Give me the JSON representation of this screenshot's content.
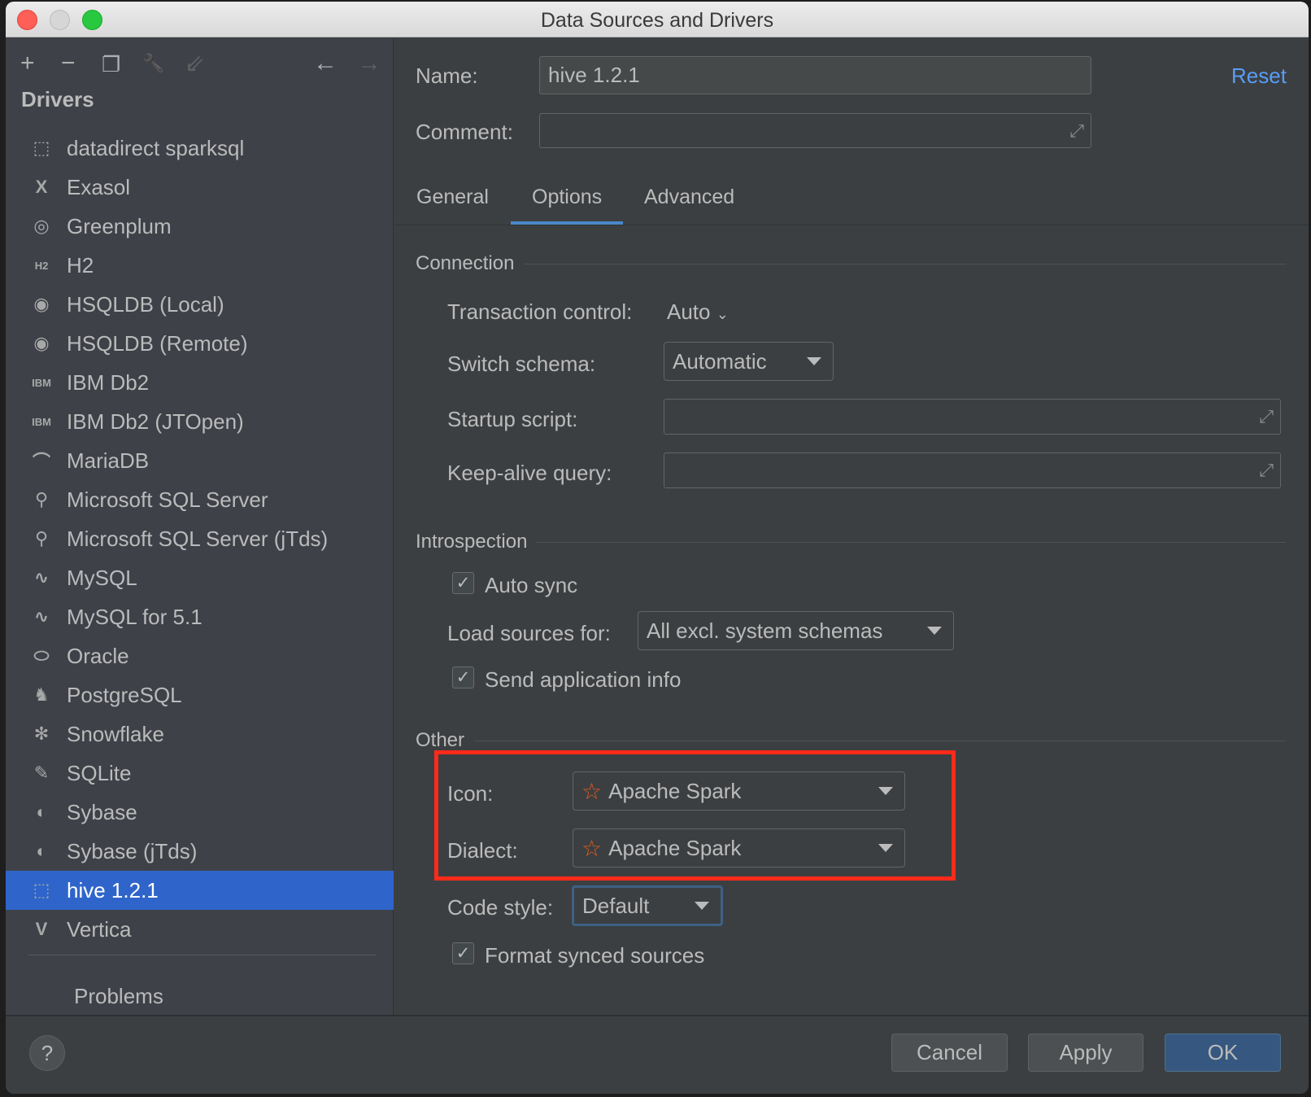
{
  "window": {
    "title": "Data Sources and Drivers"
  },
  "toolbar": {
    "add": "+",
    "remove": "−",
    "copy": "❐",
    "settings": "🔧",
    "import": "⇙",
    "back": "←",
    "forward": "→"
  },
  "sidebar": {
    "heading": "Drivers",
    "items": [
      {
        "label": "datadirect sparksql",
        "icon": "dashed-square-icon",
        "glyph": "⬚"
      },
      {
        "label": "Exasol",
        "icon": "exasol-icon",
        "glyph": "X"
      },
      {
        "label": "Greenplum",
        "icon": "greenplum-icon",
        "glyph": "◎"
      },
      {
        "label": "H2",
        "icon": "h2-icon",
        "glyph": "H2"
      },
      {
        "label": "HSQLDB (Local)",
        "icon": "hsqldb-icon",
        "glyph": "◉"
      },
      {
        "label": "HSQLDB (Remote)",
        "icon": "hsqldb-icon",
        "glyph": "◉"
      },
      {
        "label": "IBM Db2",
        "icon": "ibm-db2-icon",
        "glyph": "IBM"
      },
      {
        "label": "IBM Db2 (JTOpen)",
        "icon": "ibm-db2-icon",
        "glyph": "IBM"
      },
      {
        "label": "MariaDB",
        "icon": "mariadb-icon",
        "glyph": "⌒"
      },
      {
        "label": "Microsoft SQL Server",
        "icon": "sql-server-icon",
        "glyph": "⚲"
      },
      {
        "label": "Microsoft SQL Server (jTds)",
        "icon": "sql-server-icon",
        "glyph": "⚲"
      },
      {
        "label": "MySQL",
        "icon": "mysql-dolphin-icon",
        "glyph": "∿"
      },
      {
        "label": "MySQL for 5.1",
        "icon": "mysql-dolphin-icon",
        "glyph": "∿"
      },
      {
        "label": "Oracle",
        "icon": "oracle-icon",
        "glyph": "⬭"
      },
      {
        "label": "PostgreSQL",
        "icon": "postgresql-elephant-icon",
        "glyph": "♞"
      },
      {
        "label": "Snowflake",
        "icon": "snowflake-icon",
        "glyph": "✻"
      },
      {
        "label": "SQLite",
        "icon": "sqlite-feather-icon",
        "glyph": "✎"
      },
      {
        "label": "Sybase",
        "icon": "sybase-icon",
        "glyph": "◐"
      },
      {
        "label": "Sybase (jTds)",
        "icon": "sybase-icon",
        "glyph": "◐"
      },
      {
        "label": "hive 1.2.1",
        "icon": "dashed-square-icon",
        "glyph": "⬚",
        "selected": true
      },
      {
        "label": "Vertica",
        "icon": "vertica-icon",
        "glyph": "V"
      }
    ],
    "problems": "Problems"
  },
  "form": {
    "name_label": "Name:",
    "name_value": "hive 1.2.1",
    "comment_label": "Comment:",
    "comment_value": "",
    "reset": "Reset"
  },
  "tabs": [
    {
      "label": "General"
    },
    {
      "label": "Options",
      "active": true
    },
    {
      "label": "Advanced"
    }
  ],
  "connection": {
    "heading": "Connection",
    "transaction_label": "Transaction control:",
    "transaction_value": "Auto",
    "switch_schema_label": "Switch schema:",
    "switch_schema_value": "Automatic",
    "startup_label": "Startup script:",
    "startup_value": "",
    "keepalive_label": "Keep-alive query:",
    "keepalive_value": ""
  },
  "introspection": {
    "heading": "Introspection",
    "auto_sync": "Auto sync",
    "auto_sync_checked": true,
    "load_label": "Load sources for:",
    "load_value": "All excl. system schemas",
    "send_info": "Send application info",
    "send_info_checked": true
  },
  "other": {
    "heading": "Other",
    "icon_label": "Icon:",
    "icon_value": "Apache Spark",
    "dialect_label": "Dialect:",
    "dialect_value": "Apache Spark",
    "code_style_label": "Code style:",
    "code_style_value": "Default",
    "format_synced": "Format synced sources",
    "format_synced_checked": true
  },
  "footer": {
    "help": "?",
    "cancel": "Cancel",
    "apply": "Apply",
    "ok": "OK"
  },
  "colors": {
    "selection": "#2f65ca",
    "accent": "#589df6",
    "highlight_box": "#ff2a1a",
    "spark": "#e25a1c",
    "ok_button": "#365880"
  }
}
